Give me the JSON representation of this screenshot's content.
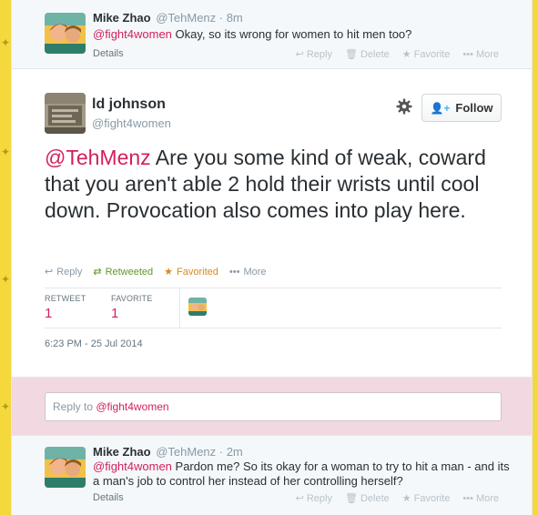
{
  "top_tweet": {
    "name": "Mike Zhao",
    "handle_time": "@TehMenz · 8m",
    "mention": "@fight4women",
    "text": " Okay, so its wrong for women to hit men too?",
    "details": "Details",
    "actions": [
      "Reply",
      "Delete",
      "Favorite",
      "More"
    ]
  },
  "main_tweet": {
    "fullname": "ld johnson",
    "handle": "@fight4women",
    "follow_label": "Follow",
    "mention": "@TehMenz",
    "text": " Are you some kind of weak, coward that you aren't able 2 hold their wrists until cool down. Provocation also comes into play here.",
    "actions": {
      "reply": "Reply",
      "retweeted": "Retweeted",
      "favorited": "Favorited",
      "more": "More"
    },
    "stats": {
      "retweet_label": "RETWEET",
      "retweet_count": "1",
      "favorite_label": "FAVORITE",
      "favorite_count": "1"
    },
    "timestamp": "6:23 PM - 25 Jul 2014"
  },
  "reply_box": {
    "prefix": "Reply to ",
    "mention": "@fight4women"
  },
  "bottom_tweet": {
    "name": "Mike Zhao",
    "handle_time": "@TehMenz · 2m",
    "mention": "@fight4women",
    "text": " Pardon me? So its okay for a woman to try to hit a man - and its a man's job to control her instead of her controlling herself?",
    "details": "Details",
    "actions": [
      "Reply",
      "Delete",
      "Favorite",
      "More"
    ]
  },
  "colors": {
    "accent": "#d41f5c",
    "retweet": "#609928",
    "favorite": "#d58a21",
    "reply_bg": "#f2d9e1",
    "page_bg": "#f3d94a"
  }
}
